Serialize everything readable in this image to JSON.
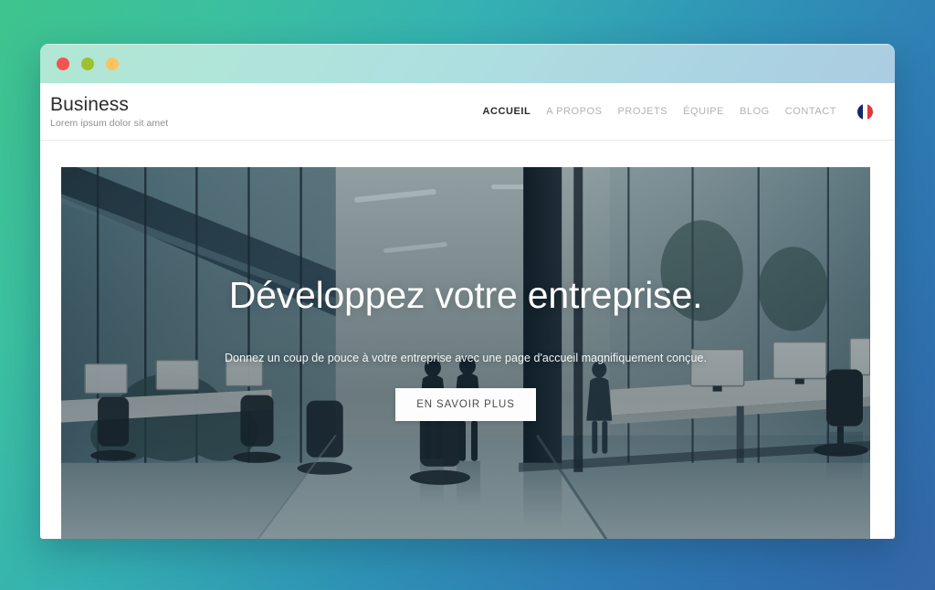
{
  "desktop": {
    "background_gradient_from": "#3ec48d",
    "background_gradient_mid": "#35b1b2",
    "background_gradient_to": "#3467a6"
  },
  "window": {
    "traffic_lights": [
      {
        "name": "close",
        "color": "#f4534f"
      },
      {
        "name": "minimize",
        "color": "#9dc12f"
      },
      {
        "name": "maximize",
        "color": "#ffc25c"
      }
    ]
  },
  "header": {
    "brand_title": "Business",
    "brand_subtitle": "Lorem ipsum dolor sit amet",
    "nav": [
      {
        "label": "ACCUEIL",
        "active": true
      },
      {
        "label": "A PROPOS",
        "active": false
      },
      {
        "label": "PROJETS",
        "active": false
      },
      {
        "label": "ÉQUIPE",
        "active": false
      },
      {
        "label": "BLOG",
        "active": false
      },
      {
        "label": "CONTACT",
        "active": false
      }
    ],
    "language_flag": {
      "name": "france-flag-icon",
      "colors": [
        "#16276b",
        "#ffffff",
        "#e4353c"
      ]
    }
  },
  "hero": {
    "title": "Développez votre entreprise.",
    "subtitle": "Donnez un coup de pouce à votre entreprise avec une page d'accueil magnifiquement conçue.",
    "cta_label": "EN SAVOIR PLUS",
    "image_alt": "Modern glass office interior with corridor, desks, chairs and people walking"
  }
}
